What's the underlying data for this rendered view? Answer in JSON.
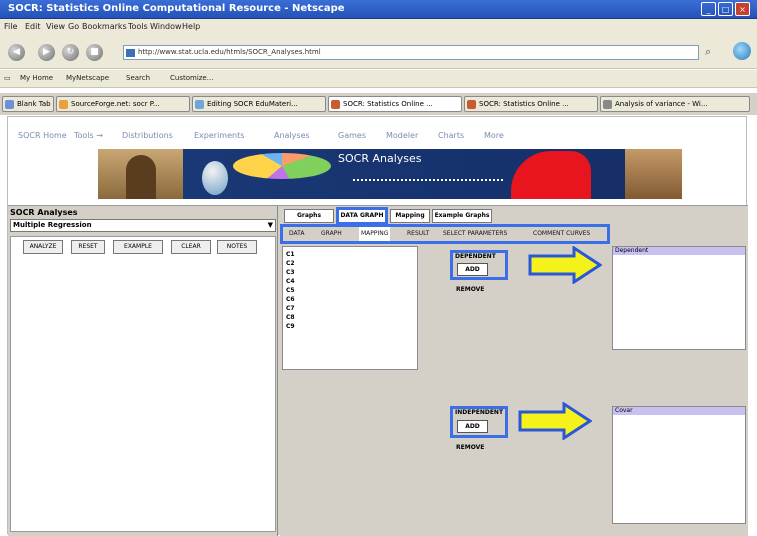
{
  "window": {
    "title": "SOCR: Statistics Online Computational Resource - Netscape",
    "controls": [
      "_",
      "□",
      "×"
    ]
  },
  "menu": [
    "File",
    "Edit",
    "View",
    "Go",
    "Bookmarks",
    "Tools",
    "Window",
    "Help"
  ],
  "nav": {
    "url": "http://www.stat.ucla.edu/htmls/SOCR_Analyses.html"
  },
  "bookmarks": [
    "My Home",
    "MyNetscape",
    "Search",
    "Customize..."
  ],
  "browser_tabs": [
    {
      "label": "Blank Tab",
      "color": "#6f8fd8"
    },
    {
      "label": "SourceForge.net: socr P...",
      "color": "#e8a23b"
    },
    {
      "label": "Editing SOCR EduMateri...",
      "color": "#6da7d8"
    },
    {
      "label": "SOCR: Statistics Online ...",
      "color": "#c85c2e"
    },
    {
      "label": "SOCR: Statistics Online ...",
      "color": "#c85c2e"
    },
    {
      "label": "Analysis of variance - Wi...",
      "color": "#888888"
    }
  ],
  "site_nav": [
    "SOCR Home",
    "Tools →",
    "Distributions",
    "Experiments",
    "Analyses",
    "Games",
    "Modeler",
    "Charts",
    "More"
  ],
  "banner": {
    "title": "SOCR Analyses"
  },
  "left_panel": {
    "label": "SOCR Analyses",
    "select_value": "Multiple Regression",
    "select_arrow": "▼",
    "buttons": [
      "ANALYZE",
      "RESET",
      "EXAMPLE",
      "CLEAR",
      "NOTES"
    ]
  },
  "right_panel": {
    "top_tabs": [
      "Graphs",
      "DATA GRAPH",
      "Mapping",
      "Example Graphs"
    ],
    "subtabs": [
      "DATA",
      "GRAPH",
      "MAPPING",
      "RESULT",
      "SELECT PARAMETERS",
      "COMMENT CURVES"
    ],
    "list_items": [
      "C1",
      "C2",
      "C3",
      "C4",
      "C5",
      "C6",
      "C7",
      "C8",
      "C9"
    ],
    "dependent": {
      "header": "Dependent",
      "add_label": "ADD",
      "add_title": "DEPENDENT",
      "remove_label": "REMOVE"
    },
    "independent": {
      "header": "Covar",
      "add_label": "ADD",
      "add_title": "INDEPENDENT",
      "remove_label": "REMOVE"
    }
  },
  "colors": {
    "highlight_frame": "#3b6fe8",
    "arrow_fill": "#f4f21a",
    "arrow_stroke": "#2a57d6"
  }
}
